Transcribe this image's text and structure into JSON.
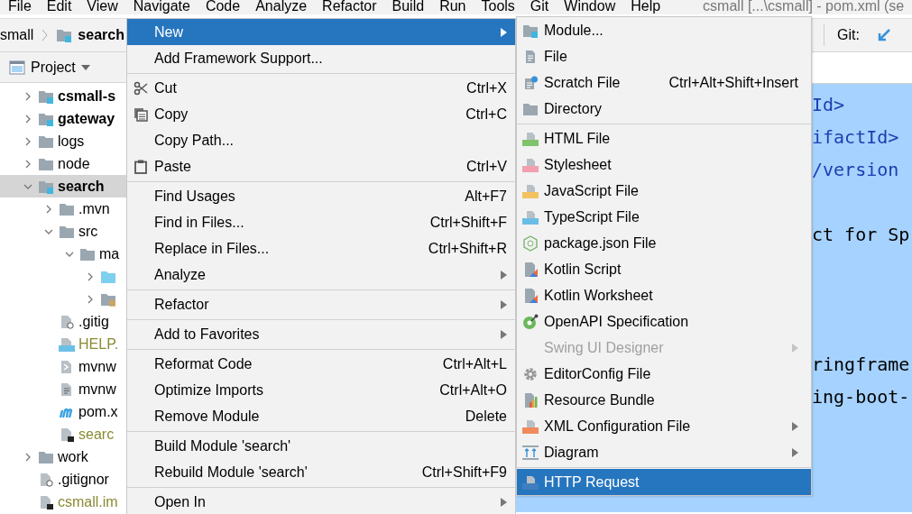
{
  "menu_bar": {
    "items": [
      "File",
      "Edit",
      "View",
      "Navigate",
      "Code",
      "Analyze",
      "Refactor",
      "Build",
      "Run",
      "Tools",
      "Git",
      "Window",
      "Help"
    ],
    "title": "csmall [...\\csmall] - pom.xml (se"
  },
  "toolbar": {
    "breadcrumb": [
      "small",
      "search"
    ],
    "git_label": "Git:"
  },
  "project_panel": {
    "title": "Project",
    "tree": [
      {
        "label": "csmall-s",
        "kind": "module",
        "expanded": false,
        "selected": false
      },
      {
        "label": "gateway",
        "kind": "module",
        "expanded": false,
        "selected": false
      },
      {
        "label": "logs",
        "kind": "folder",
        "expanded": false,
        "selected": false
      },
      {
        "label": "node",
        "kind": "folder",
        "expanded": false,
        "selected": false
      },
      {
        "label": "search",
        "kind": "module",
        "expanded": true,
        "selected": true,
        "children": [
          {
            "label": ".mvn",
            "kind": "folder",
            "expanded": false,
            "selected": false
          },
          {
            "label": "src",
            "kind": "folder",
            "expanded": true,
            "selected": false,
            "children": [
              {
                "label": "ma",
                "kind": "folder",
                "expanded": true,
                "selected": false,
                "children": [
                  {
                    "kind": "sources",
                    "expanded": false,
                    "selected": false
                  },
                  {
                    "kind": "resources",
                    "expanded": false,
                    "selected": false
                  }
                ]
              }
            ]
          },
          {
            "label": ".gitig",
            "kind": "ignorefile",
            "selected": false
          },
          {
            "label": "HELP.",
            "kind": "markdown",
            "selected": false,
            "color": "#8a8a33"
          },
          {
            "label": "mvnw",
            "kind": "script",
            "selected": false
          },
          {
            "label": "mvnw",
            "kind": "text",
            "selected": false
          },
          {
            "label": "pom.x",
            "kind": "maven",
            "selected": false
          },
          {
            "label": "searc",
            "kind": "iml",
            "selected": false,
            "color": "#8a8a33"
          }
        ]
      },
      {
        "label": "work",
        "kind": "folder",
        "expanded": false,
        "selected": false
      },
      {
        "label": ".gitignor",
        "kind": "ignorefile",
        "selected": false
      },
      {
        "label": "csmall.im",
        "kind": "iml",
        "selected": false,
        "color": "#8a8a33"
      }
    ]
  },
  "editor": {
    "lines": [
      {
        "kind": "tag",
        "text": "Id>"
      },
      {
        "kind": "tag",
        "text": "ifactId>"
      },
      {
        "kind": "tag",
        "text": "/version"
      },
      {
        "kind": "blank"
      },
      {
        "kind": "plain",
        "text": "ct for Sp"
      },
      {
        "kind": "blank"
      },
      {
        "kind": "blank"
      },
      {
        "kind": "blank"
      },
      {
        "kind": "plain",
        "text": "ringframe"
      },
      {
        "kind": "plain",
        "text": "ing-boot-"
      }
    ]
  },
  "context_menu": {
    "items": [
      {
        "kind": "item",
        "label": "New",
        "submenu": true,
        "selected": true
      },
      {
        "kind": "item",
        "label": "Add Framework Support...",
        "selected": false
      },
      {
        "kind": "separator"
      },
      {
        "kind": "item",
        "label": "Cut",
        "shortcut": "Ctrl+X",
        "selected": false
      },
      {
        "kind": "item",
        "label": "Copy",
        "shortcut": "Ctrl+C",
        "selected": false
      },
      {
        "kind": "item",
        "label": "Copy Path...",
        "selected": false
      },
      {
        "kind": "item",
        "label": "Paste",
        "shortcut": "Ctrl+V",
        "selected": false
      },
      {
        "kind": "separator"
      },
      {
        "kind": "item",
        "label": "Find Usages",
        "shortcut": "Alt+F7",
        "selected": false
      },
      {
        "kind": "item",
        "label": "Find in Files...",
        "shortcut": "Ctrl+Shift+F",
        "selected": false
      },
      {
        "kind": "item",
        "label": "Replace in Files...",
        "shortcut": "Ctrl+Shift+R",
        "selected": false
      },
      {
        "kind": "item",
        "label": "Analyze",
        "submenu": true,
        "selected": false
      },
      {
        "kind": "separator"
      },
      {
        "kind": "item",
        "label": "Refactor",
        "submenu": true,
        "selected": false
      },
      {
        "kind": "separator"
      },
      {
        "kind": "item",
        "label": "Add to Favorites",
        "submenu": true,
        "selected": false
      },
      {
        "kind": "separator"
      },
      {
        "kind": "item",
        "label": "Reformat Code",
        "shortcut": "Ctrl+Alt+L",
        "selected": false
      },
      {
        "kind": "item",
        "label": "Optimize Imports",
        "shortcut": "Ctrl+Alt+O",
        "selected": false
      },
      {
        "kind": "item",
        "label": "Remove Module",
        "shortcut": "Delete",
        "selected": false
      },
      {
        "kind": "separator"
      },
      {
        "kind": "item",
        "label": "Build Module 'search'",
        "selected": false
      },
      {
        "kind": "item",
        "label": "Rebuild Module 'search'",
        "shortcut": "Ctrl+Shift+F9",
        "selected": false
      },
      {
        "kind": "separator"
      },
      {
        "kind": "item",
        "label": "Open In",
        "submenu": true,
        "selected": false
      }
    ]
  },
  "new_submenu": {
    "items": [
      {
        "kind": "item",
        "label": "Module...",
        "selected": false
      },
      {
        "kind": "item",
        "label": "File",
        "selected": false
      },
      {
        "kind": "item",
        "label": "Scratch File",
        "shortcut": "Ctrl+Alt+Shift+Insert",
        "selected": false
      },
      {
        "kind": "item",
        "label": "Directory",
        "selected": false
      },
      {
        "kind": "separator"
      },
      {
        "kind": "item",
        "label": "HTML File",
        "selected": false
      },
      {
        "kind": "item",
        "label": "Stylesheet",
        "selected": false
      },
      {
        "kind": "item",
        "label": "JavaScript File",
        "selected": false
      },
      {
        "kind": "item",
        "label": "TypeScript File",
        "selected": false
      },
      {
        "kind": "item",
        "label": "package.json File",
        "selected": false
      },
      {
        "kind": "item",
        "label": "Kotlin Script",
        "selected": false
      },
      {
        "kind": "item",
        "label": "Kotlin Worksheet",
        "selected": false
      },
      {
        "kind": "item",
        "label": "OpenAPI Specification",
        "selected": false
      },
      {
        "kind": "item",
        "label": "Swing UI Designer",
        "submenu": true,
        "disabled": true,
        "selected": false
      },
      {
        "kind": "item",
        "label": "EditorConfig File",
        "selected": false
      },
      {
        "kind": "item",
        "label": "Resource Bundle",
        "selected": false
      },
      {
        "kind": "item",
        "label": "XML Configuration File",
        "submenu": true,
        "selected": false
      },
      {
        "kind": "item",
        "label": "Diagram",
        "submenu": true,
        "selected": false
      },
      {
        "kind": "separator"
      },
      {
        "kind": "item",
        "label": "HTTP Request",
        "selected": true
      }
    ]
  }
}
